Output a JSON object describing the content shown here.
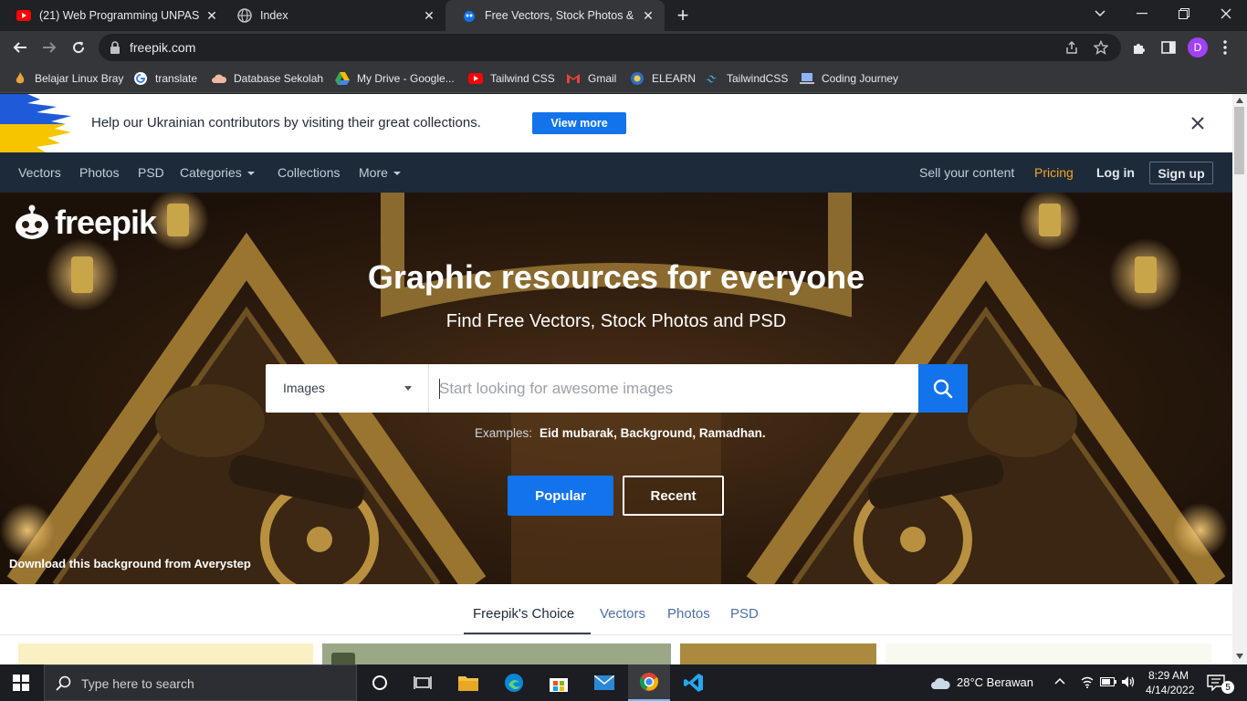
{
  "browser": {
    "tabs": [
      {
        "title": "(21) Web Programming UNPAS -",
        "icon": "youtube-icon"
      },
      {
        "title": "Index",
        "icon": "globe-icon"
      },
      {
        "title": "Free Vectors, Stock Photos & PSD",
        "icon": "freepik-icon",
        "active": true
      }
    ],
    "new_tab": "+",
    "close_glyph": "✕",
    "address": "freepik.com",
    "profile_initial": "D",
    "bookmarks": [
      {
        "label": "Belajar Linux Bray",
        "icon": "flame-icon"
      },
      {
        "label": "translate",
        "icon": "google-icon"
      },
      {
        "label": "Database Sekolah",
        "icon": "cloud-icon"
      },
      {
        "label": "My Drive - Google...",
        "icon": "drive-icon"
      },
      {
        "label": "Tailwind CSS",
        "icon": "youtube-icon"
      },
      {
        "label": "Gmail",
        "icon": "gmail-icon"
      },
      {
        "label": "ELEARN",
        "icon": "elearn-icon"
      },
      {
        "label": "TailwindCSS",
        "icon": "tailwind-icon"
      },
      {
        "label": "Coding Journey",
        "icon": "laptop-icon"
      }
    ]
  },
  "banner": {
    "text": "Help our Ukrainian contributors by visiting their great collections.",
    "button": "View more",
    "colors": {
      "blue": "#1e5bd8",
      "yellow": "#f6c500"
    }
  },
  "nav": {
    "left": [
      "Vectors",
      "Photos",
      "PSD",
      "Categories",
      "Collections",
      "More"
    ],
    "sell": "Sell your content",
    "pricing": "Pricing",
    "login": "Log in",
    "signup": "Sign up",
    "pricing_color": "#f5a623"
  },
  "hero": {
    "logo": "freepik",
    "title": "Graphic resources for everyone",
    "subtitle": "Find Free Vectors, Stock Photos and PSD",
    "search_type": "Images",
    "search_placeholder": "Start looking for awesome images",
    "examples_label": "Examples:",
    "examples": [
      "Eid mubarak",
      "Background",
      "Ramadhan"
    ],
    "popular": "Popular",
    "recent": "Recent",
    "credit": "Download this background from Averystep"
  },
  "content_tabs": [
    "Freepik's Choice",
    "Vectors",
    "Photos",
    "PSD"
  ],
  "taskbar": {
    "search_placeholder": "Type here to search",
    "weather": "28°C  Berawan",
    "time": "8:29 AM",
    "date": "4/14/2022",
    "notification_count": "5"
  }
}
